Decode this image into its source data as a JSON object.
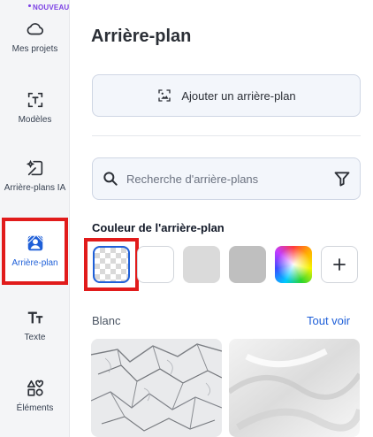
{
  "sidebar": {
    "badge": "NOUVEAU",
    "items": [
      {
        "label": "Mes projets",
        "icon": "cloud-icon"
      },
      {
        "label": "Modèles",
        "icon": "template-icon"
      },
      {
        "label": "Arrière-plans IA",
        "icon": "ai-background-icon"
      },
      {
        "label": "Arrière-plan",
        "icon": "background-icon",
        "active": true
      },
      {
        "label": "Texte",
        "icon": "text-icon"
      },
      {
        "label": "Éléments",
        "icon": "elements-icon"
      }
    ]
  },
  "main": {
    "title": "Arrière-plan",
    "add_button": "Ajouter un arrière-plan",
    "search_placeholder": "Recherche d'arrière-plans",
    "color_section": "Couleur de l'arrière-plan",
    "swatches": [
      {
        "name": "transparent"
      },
      {
        "name": "white",
        "color": "#ffffff"
      },
      {
        "name": "light-gray",
        "color": "#dadada"
      },
      {
        "name": "gray",
        "color": "#bfbfbf"
      },
      {
        "name": "color-picker"
      },
      {
        "name": "add-color"
      }
    ],
    "images_section": "Blanc",
    "see_all": "Tout voir"
  },
  "colors": {
    "accent": "#1e5fd8",
    "highlight": "#e11b1b",
    "badge": "#7b3fe4"
  }
}
